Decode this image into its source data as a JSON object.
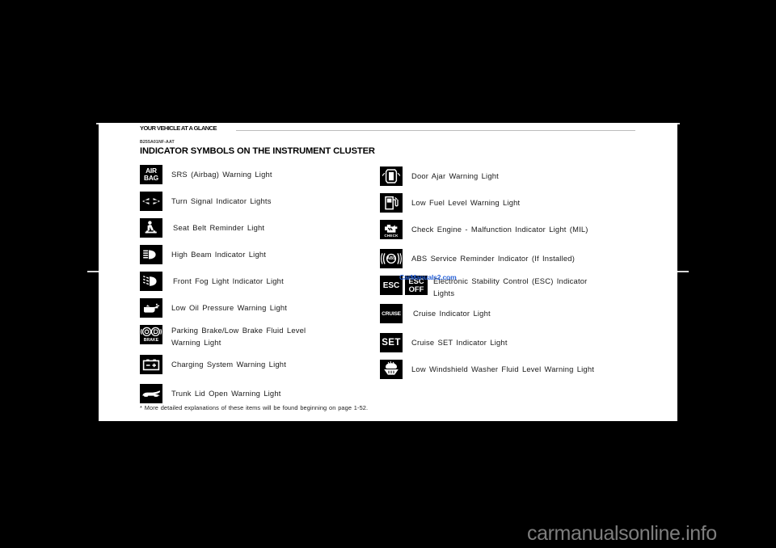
{
  "page": {
    "running_head": "YOUR VEHICLE AT A GLANCE",
    "section_code": "B255A01NF-AAT",
    "section_title": "INDICATOR SYMBOLS ON THE INSTRUMENT CLUSTER",
    "footnote": "* More detailed explanations of these items will be found beginning on page 1-52."
  },
  "watermarks": {
    "overlay_blue": "CarManuals2.com",
    "bottom_grey": "carmanualsonline.info",
    "blue_hex": "#2a63d8",
    "grey_hex": "#7e7e7e"
  },
  "left_column": [
    {
      "icon": "airbag-icon",
      "icon_text_line1": "AIR",
      "icon_text_line2": "BAG",
      "label": "SRS (Airbag) Warning Light"
    },
    {
      "icon": "turn-signal-icon",
      "label": "Turn Signal Indicator Lights"
    },
    {
      "icon": "seat-belt-icon",
      "label": "Seat Belt Reminder Light"
    },
    {
      "icon": "high-beam-icon",
      "label": "High Beam Indicator Light"
    },
    {
      "icon": "front-fog-light-icon",
      "label": "Front Fog Light Indicator Light"
    },
    {
      "icon": "oil-can-icon",
      "label": "Low Oil Pressure Warning Light"
    },
    {
      "icon": "parking-brake-icon",
      "icon_text": "BRAKE",
      "label": "Parking Brake/Low Brake Fluid Level\nWarning Light"
    },
    {
      "icon": "battery-icon",
      "label": "Charging System Warning Light"
    },
    {
      "icon": "trunk-open-icon",
      "label": "Trunk Lid Open Warning Light"
    }
  ],
  "right_column": [
    {
      "icon": "door-ajar-icon",
      "label": "Door Ajar Warning Light"
    },
    {
      "icon": "fuel-pump-icon",
      "label": "Low Fuel Level Warning Light"
    },
    {
      "icon": "check-engine-icon",
      "icon_text": "CHECK",
      "label": "Check Engine - Malfunction Indicator Light (MIL)"
    },
    {
      "icon": "abs-icon",
      "icon_text": "ABS",
      "label": "ABS Service Reminder Indicator (If Installed)"
    },
    {
      "icon": "esc-icon",
      "icon_text": "ESC",
      "icon2": "esc-off-icon",
      "icon2_text_line1": "ESC",
      "icon2_text_line2": "OFF",
      "label": "Electronic Stability Control (ESC) Indicator\nLights"
    },
    {
      "icon": "cruise-icon",
      "icon_text": "CRUISE",
      "label": "Cruise Indicator Light"
    },
    {
      "icon": "cruise-set-icon",
      "icon_text": "SET",
      "label": "Cruise SET Indicator Light"
    },
    {
      "icon": "washer-fluid-icon",
      "label": "Low Windshield Washer Fluid Level Warning Light"
    }
  ]
}
